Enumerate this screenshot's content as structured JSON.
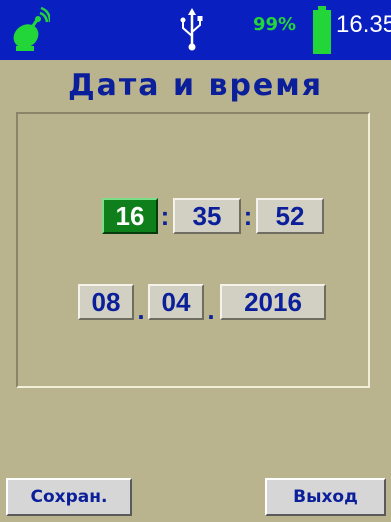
{
  "status_bar": {
    "left_icon": "satellite-dish-icon",
    "center_icon": "usb-icon",
    "battery_percent": "99%",
    "battery_icon": "battery-full-icon",
    "time": "16.35",
    "colors": {
      "background": "#0a1fbf",
      "battery": "#22d63a"
    }
  },
  "title": "Дата и время",
  "time_fields": {
    "hours": "16",
    "minutes": "35",
    "seconds": "52",
    "separator": ":"
  },
  "date_fields": {
    "day": "08",
    "month": "04",
    "year": "2016",
    "separator": "."
  },
  "active_field": "hours",
  "buttons": {
    "save_label": "Сохран.",
    "exit_label": "Выход"
  },
  "colors": {
    "background": "#b9b48e",
    "text": "#0b1f9a",
    "active_field": "#0f7f1c"
  }
}
